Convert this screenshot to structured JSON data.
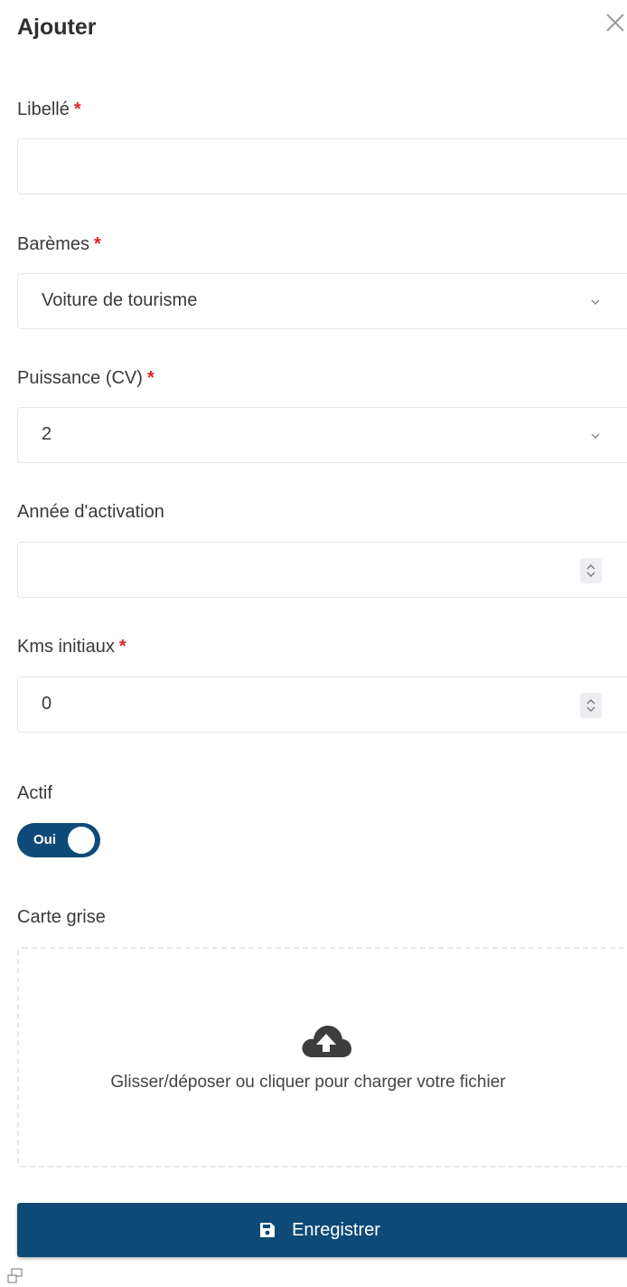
{
  "header": {
    "title": "Ajouter"
  },
  "form": {
    "libelle": {
      "label": "Libellé",
      "required": "*",
      "value": ""
    },
    "baremes": {
      "label": "Barèmes",
      "required": "*",
      "value": "Voiture de tourisme"
    },
    "puissance": {
      "label": "Puissance (CV)",
      "required": "*",
      "value": "2"
    },
    "annee": {
      "label": "Année d'activation",
      "value": ""
    },
    "kms": {
      "label": "Kms initiaux",
      "required": "*",
      "value": "0"
    },
    "actif": {
      "label": "Actif",
      "toggle_text": "Oui",
      "checked": true
    },
    "carte_grise": {
      "label": "Carte grise",
      "dropzone_text": "Glisser/déposer ou cliquer pour charger votre fichier"
    }
  },
  "actions": {
    "save_label": "Enregistrer"
  },
  "colors": {
    "primary": "#0e4a77",
    "required": "#e02424",
    "border": "#e3e6ea"
  },
  "icons": {
    "close": "close-icon",
    "chevron": "chevron-down-icon",
    "spinner": "spinner-arrows-icon",
    "upload": "cloud-upload-icon",
    "save": "floppy-disk-icon",
    "footer": "window-icon"
  }
}
